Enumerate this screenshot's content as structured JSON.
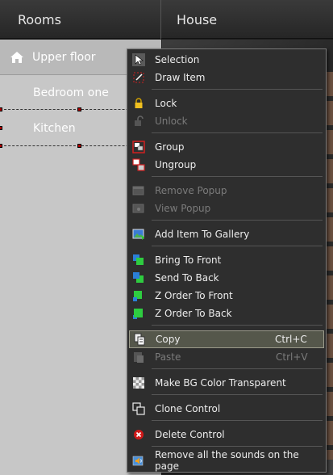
{
  "header": {
    "rooms_title": "Rooms",
    "house_title": "House"
  },
  "rooms": {
    "upper_floor": "Upper floor",
    "bedroom_one": "Bedroom one",
    "kitchen": "Kitchen"
  },
  "menu": {
    "selection": "Selection",
    "draw_item": "Draw Item",
    "lock": "Lock",
    "unlock": "Unlock",
    "group": "Group",
    "ungroup": "Ungroup",
    "remove_popup": "Remove Popup",
    "view_popup": "View Popup",
    "add_to_gallery": "Add Item To Gallery",
    "bring_to_front": "Bring To Front",
    "send_to_back": "Send To Back",
    "z_order_front": "Z Order To Front",
    "z_order_back": "Z Order To Back",
    "copy": "Copy",
    "copy_shortcut": "Ctrl+C",
    "paste": "Paste",
    "paste_shortcut": "Ctrl+V",
    "make_bg_transparent": "Make BG Color Transparent",
    "clone_control": "Clone Control",
    "delete_control": "Delete Control",
    "remove_sounds": "Remove all the sounds on the page"
  },
  "icons": {
    "home": "home-icon",
    "selection": "cursor-icon",
    "draw": "draw-icon",
    "lock": "lock-icon",
    "unlock": "unlock-icon",
    "group": "group-icon",
    "ungroup": "ungroup-icon",
    "gallery": "gallery-icon",
    "copy": "copy-icon",
    "paste": "paste-icon",
    "transparent": "checkerboard-icon",
    "clone": "clone-icon",
    "delete": "delete-icon",
    "sound": "sound-icon"
  },
  "colors": {
    "menu_bg": "#2e2e2e",
    "highlight": "#55574b",
    "selection_handle": "#b10000",
    "panel_bg": "#c7c7c7"
  }
}
